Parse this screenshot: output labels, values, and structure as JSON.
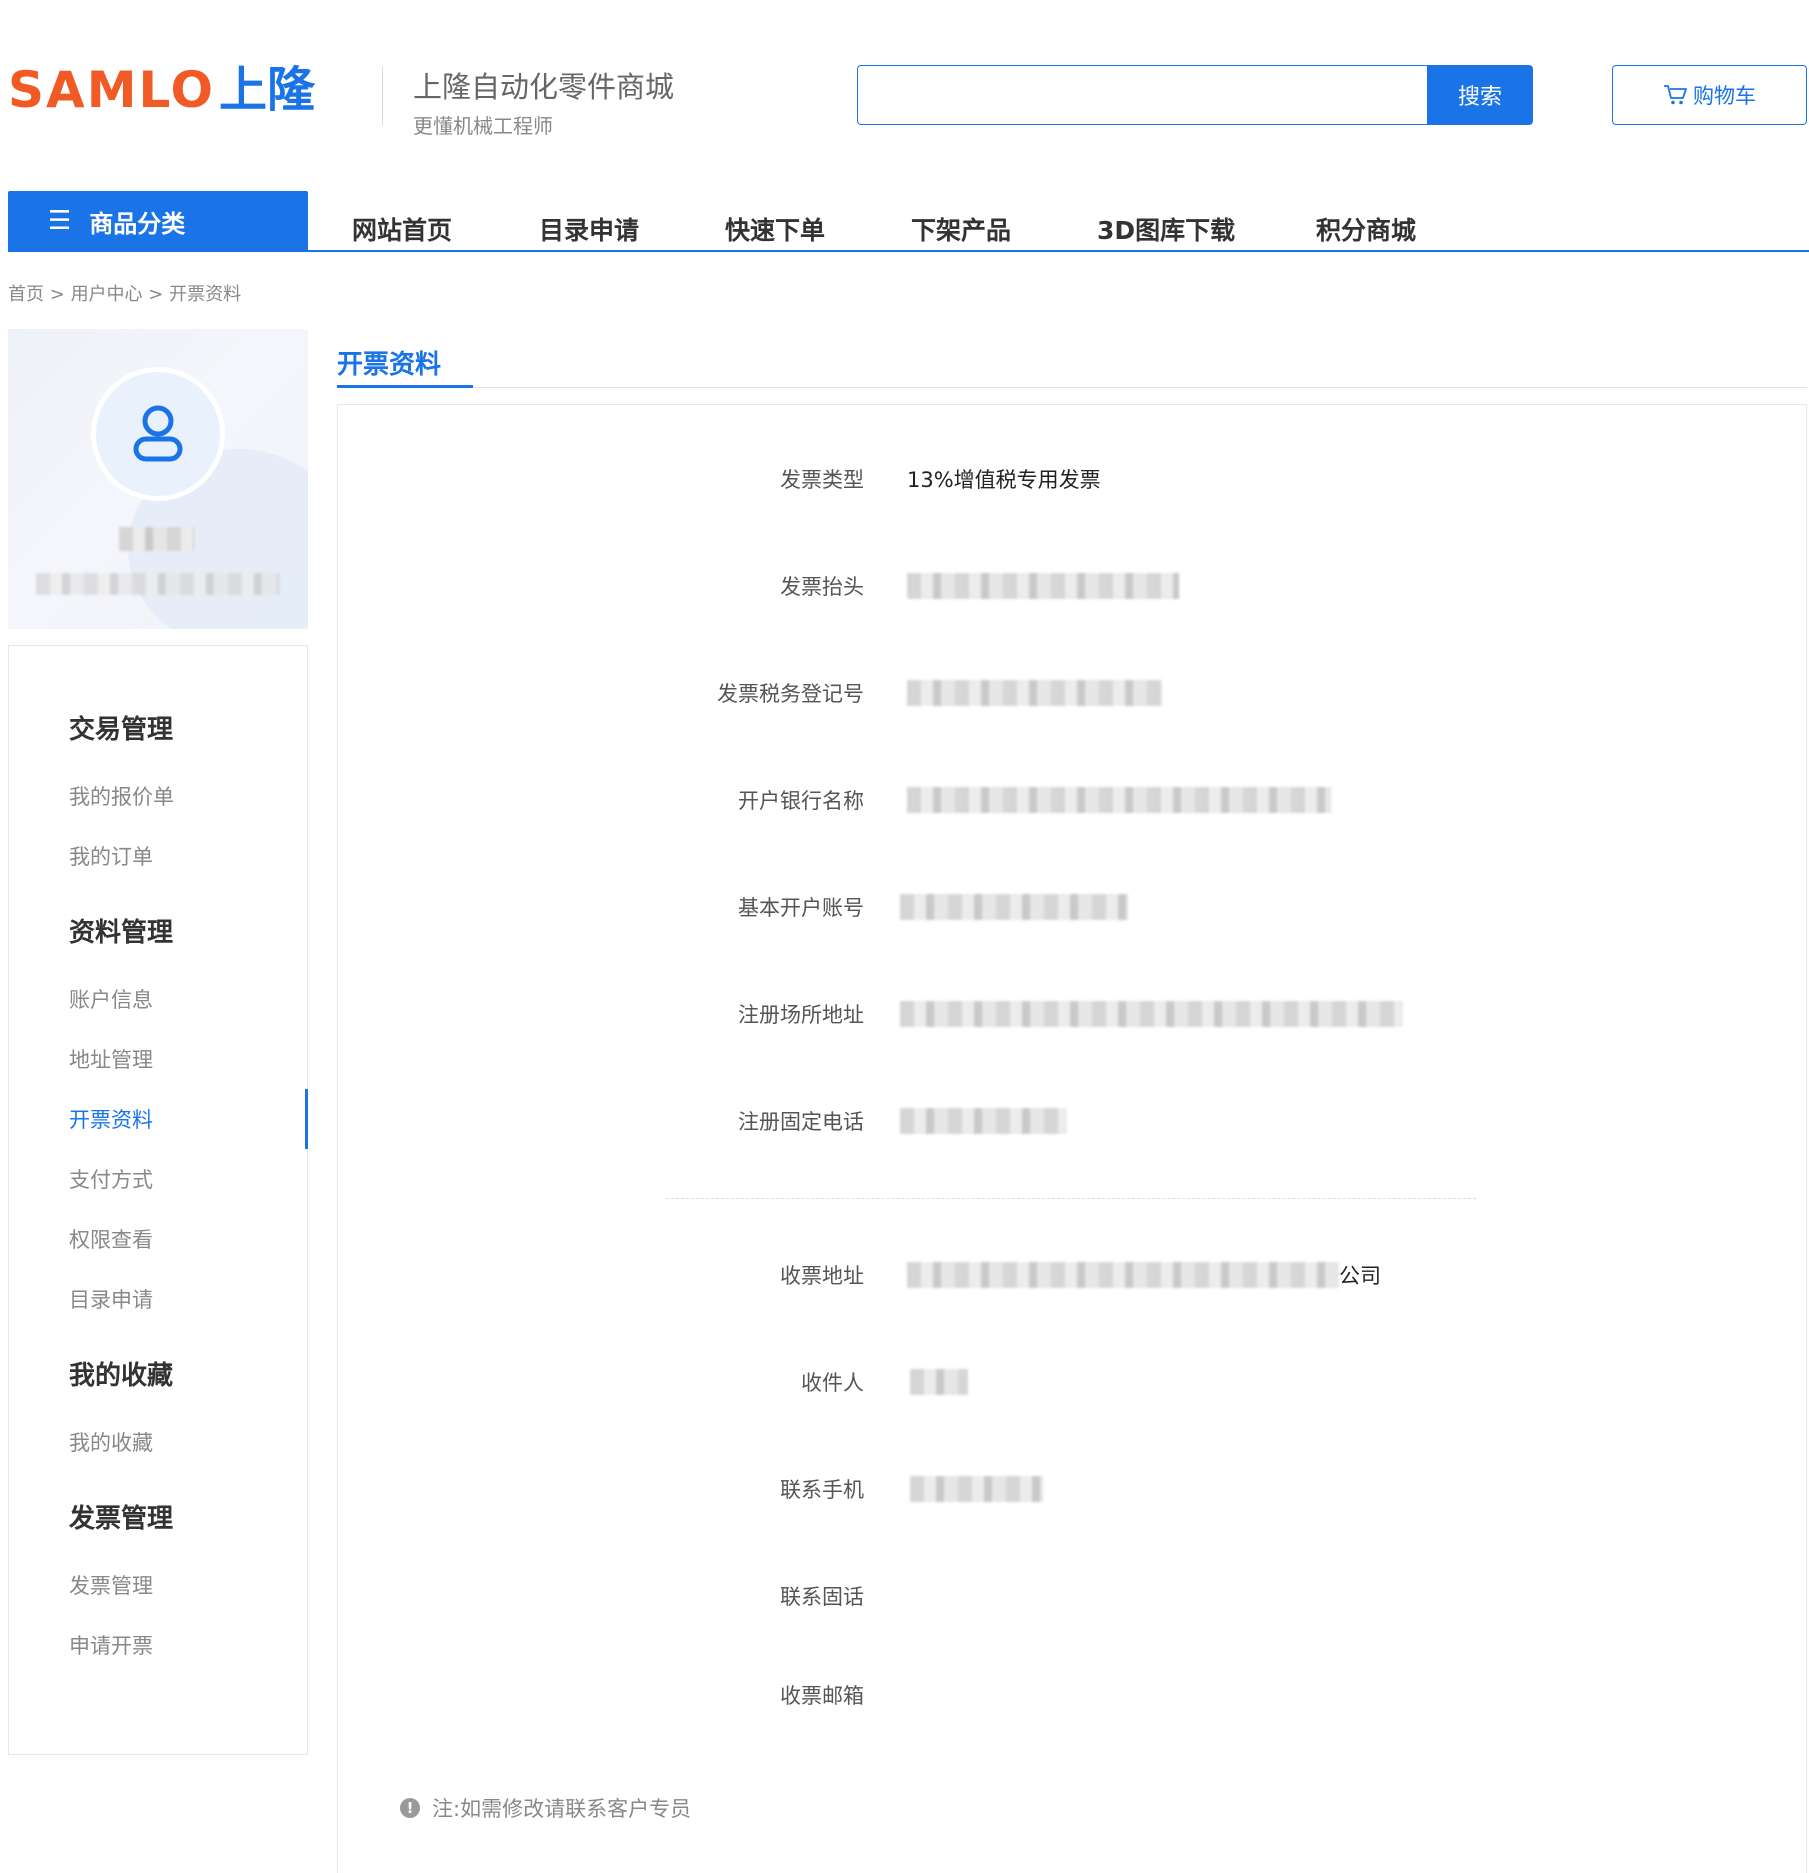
{
  "header": {
    "logo_latin": "SAMLO",
    "logo_cn": "上隆",
    "brand_title": "上隆自动化零件商城",
    "brand_sub": "更懂机械工程师",
    "search_placeholder": "",
    "search_button": "搜索",
    "cart_label": "购物车"
  },
  "nav": {
    "category_label": "商品分类",
    "items": [
      "网站首页",
      "目录申请",
      "快速下单",
      "下架产品",
      "3D图库下载",
      "积分商城"
    ]
  },
  "breadcrumb": [
    "首页",
    "用户中心",
    "开票资料"
  ],
  "breadcrumb_sep": ">",
  "sidebar": {
    "groups": [
      {
        "title": "交易管理",
        "items": [
          "我的报价单",
          "我的订单"
        ]
      },
      {
        "title": "资料管理",
        "items": [
          "账户信息",
          "地址管理",
          "开票资料",
          "支付方式",
          "权限查看",
          "目录申请"
        ]
      },
      {
        "title": "我的收藏",
        "items": [
          "我的收藏"
        ]
      },
      {
        "title": "发票管理",
        "items": [
          "发票管理",
          "申请开票"
        ]
      }
    ],
    "active_item": "开票资料"
  },
  "main": {
    "title": "开票资料",
    "fields": [
      {
        "label": "发票类型",
        "value": "13%增值税专用发票"
      },
      {
        "label": "发票抬头",
        "value": ""
      },
      {
        "label": "发票税务登记号",
        "value": ""
      },
      {
        "label": "开户银行名称",
        "value": ""
      },
      {
        "label": "基本开户账号",
        "value": ""
      },
      {
        "label": "注册场所地址",
        "value": ""
      },
      {
        "label": "注册固定电话",
        "value": ""
      }
    ],
    "fields2": [
      {
        "label": "收票地址",
        "value": "公司"
      },
      {
        "label": "收件人",
        "value": ""
      },
      {
        "label": "联系手机",
        "value": ""
      },
      {
        "label": "联系固话",
        "value": ""
      },
      {
        "label": "收票邮箱",
        "value": ""
      }
    ],
    "note": "注:如需修改请联系客户专员"
  },
  "colors": {
    "accent": "#1a74e8",
    "logo_orange": "#f15a24"
  }
}
